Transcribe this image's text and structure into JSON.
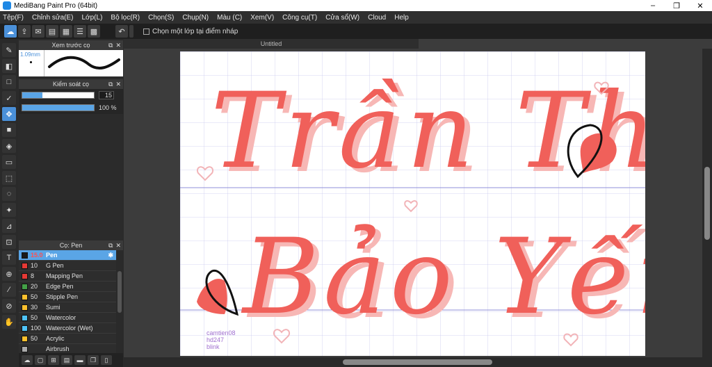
{
  "window": {
    "title": "MediBang Paint Pro (64bit)",
    "controls": [
      "–",
      "❐",
      "✕"
    ]
  },
  "menu": [
    "Tệp(F)",
    "Chỉnh sửa(E)",
    "Lớp(L)",
    "Bộ lọc(R)",
    "Chọn(S)",
    "Chụp(N)",
    "Màu (C)",
    "Xem(V)",
    "Công cụ(T)",
    "Cửa sổ(W)",
    "Cloud",
    "Help"
  ],
  "toolbar": {
    "undo_icon": "undo-icon",
    "checkbox_label": "Chọn một lớp tại điểm nháp"
  },
  "brush_preview": {
    "title": "Xem trước cọ",
    "size": "1.09mm"
  },
  "brush_control": {
    "title": "Kiểm soát cọ",
    "size_value": "15",
    "size_fill": 0.28,
    "opacity_value": "100 %",
    "opacity_fill": 1.0
  },
  "brush_list": {
    "title": "Cọ: Pen",
    "items": [
      {
        "size": "15.0",
        "name": "Pen",
        "color": "#1a1a1a",
        "selected": true
      },
      {
        "size": "10",
        "name": "G Pen",
        "color": "#e53935"
      },
      {
        "size": "8",
        "name": "Mapping Pen",
        "color": "#e53935"
      },
      {
        "size": "20",
        "name": "Edge Pen",
        "color": "#43a047"
      },
      {
        "size": "50",
        "name": "Stipple Pen",
        "color": "#fbc02d"
      },
      {
        "size": "30",
        "name": "Sumi",
        "color": "#fbc02d"
      },
      {
        "size": "50",
        "name": "Watercolor",
        "color": "#4fc3f7"
      },
      {
        "size": "100",
        "name": "Watercolor (Wet)",
        "color": "#4fc3f7"
      },
      {
        "size": "50",
        "name": "Acrylic",
        "color": "#fbc02d"
      },
      {
        "size": "",
        "name": "Airbrush",
        "color": "#aaaaaa"
      }
    ]
  },
  "document": {
    "tab": "Untitled"
  },
  "artwork": {
    "line1": "Trần Thị",
    "line2": "Bảo Yến",
    "watermark": [
      "camtien08",
      "hd247",
      "blink"
    ],
    "ink_color": "#f0605a",
    "shadow_color": "#f7b7b5"
  }
}
